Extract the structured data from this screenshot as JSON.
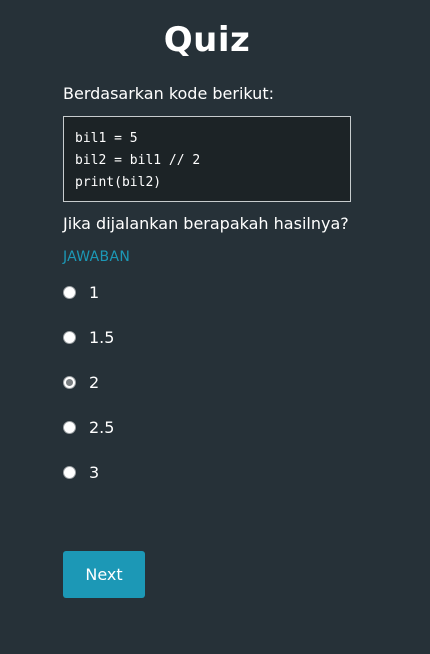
{
  "title": "Quiz",
  "intro": "Berdasarkan kode berikut:",
  "code": "bil1 = 5\nbil2 = bil1 // 2\nprint(bil2)",
  "question": "Jika dijalankan berapakah hasilnya?",
  "answer_label": "JAWABAN",
  "options": [
    {
      "label": "1",
      "selected": false
    },
    {
      "label": "1.5",
      "selected": false
    },
    {
      "label": "2",
      "selected": true
    },
    {
      "label": "2.5",
      "selected": false
    },
    {
      "label": "3",
      "selected": false
    }
  ],
  "next_label": "Next",
  "colors": {
    "background": "#263138",
    "accent": "#1c98b6",
    "code_background": "#1c2326"
  }
}
